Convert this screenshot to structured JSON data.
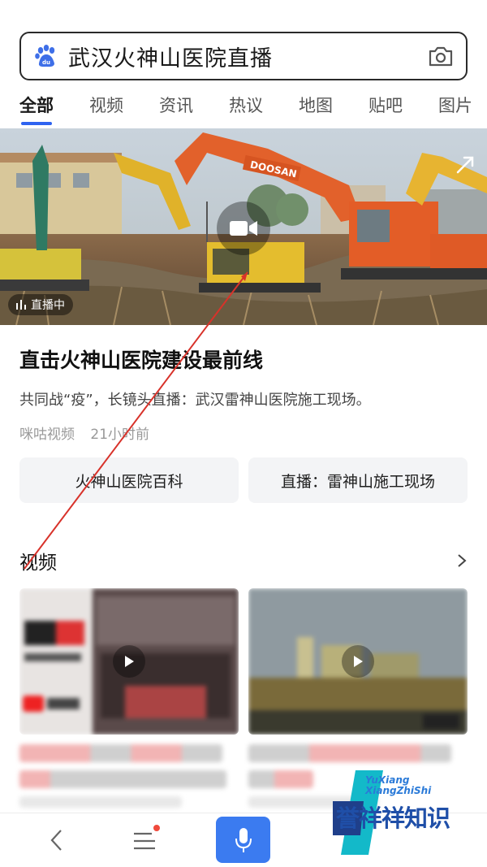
{
  "search": {
    "query": "武汉火神山医院直播"
  },
  "tabs": [
    {
      "label": "全部",
      "active": true
    },
    {
      "label": "视频"
    },
    {
      "label": "资讯"
    },
    {
      "label": "热议"
    },
    {
      "label": "地图"
    },
    {
      "label": "贴吧"
    },
    {
      "label": "图片"
    }
  ],
  "hero": {
    "live_badge": "直播中",
    "sign_text": "DOOSAN"
  },
  "result": {
    "title": "直击火神山医院建设最前线",
    "description": "共同战“疫”，长镜头直播：武汉雷神山医院施工现场。",
    "source": "咪咕视频",
    "time": "21小时前"
  },
  "related": [
    {
      "label": "火神山医院百科"
    },
    {
      "label": "直播：雷神山施工现场"
    }
  ],
  "videos_section": {
    "title": "视频"
  },
  "watermark": {
    "en_line1": "YuXiang",
    "en_line2": "XiangZhiShi",
    "cn": "誉祥祥知识"
  },
  "colors": {
    "accent": "#2e63f0",
    "mic_button": "#3b7bf0",
    "annotation": "#d8322a"
  },
  "icons": {
    "search_logo": "baidu-paw-icon",
    "camera": "camera-icon",
    "play": "video-camera-icon",
    "share": "share-icon",
    "chevron": "chevron-right-icon",
    "back": "back-arrow-icon",
    "menu": "menu-icon",
    "mic": "microphone-icon"
  }
}
